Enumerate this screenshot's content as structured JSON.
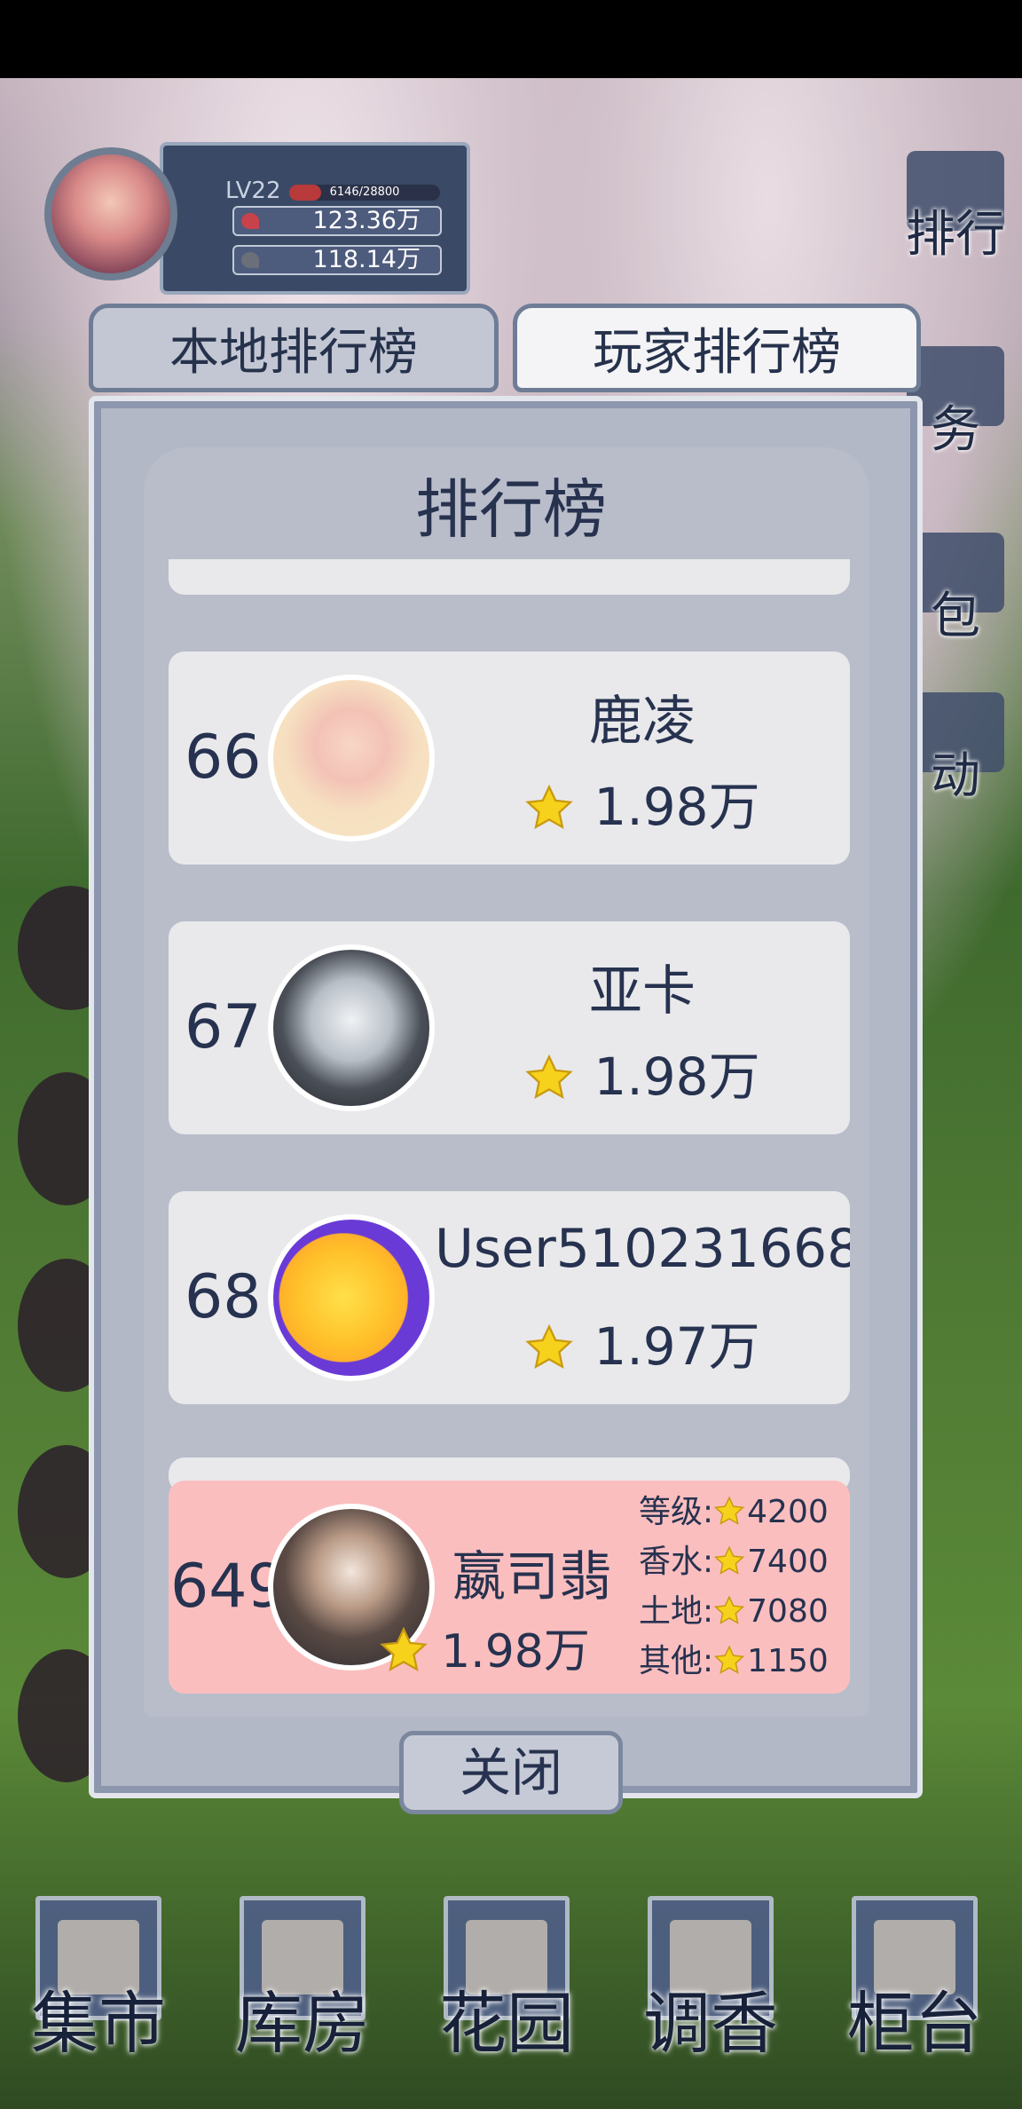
{
  "hud": {
    "level": "LV22",
    "exp_text": "6146/28800",
    "exp_progress": 0.213,
    "stat_1": "123.36万",
    "stat_2": "118.14万"
  },
  "side_menu": [
    {
      "label": "排行",
      "icon": "ranking-icon"
    },
    {
      "label": "务",
      "icon": "task-icon"
    },
    {
      "label": "包",
      "icon": "bag-icon"
    },
    {
      "label": "动",
      "icon": "activity-icon"
    }
  ],
  "tabs": {
    "local": "本地排行榜",
    "player": "玩家排行榜"
  },
  "modal": {
    "title": "排行榜",
    "close_label": "关闭"
  },
  "entries": [
    {
      "rank": "66",
      "name": "鹿凌",
      "score": "1.98万"
    },
    {
      "rank": "67",
      "name": "亚卡",
      "score": "1.98万"
    },
    {
      "rank": "68",
      "name": "User510231668",
      "score": "1.97万"
    }
  ],
  "self_entry": {
    "rank": "649",
    "name": "嬴司翡",
    "score": "1.98万",
    "stats": [
      {
        "label": "等级:",
        "value": "4200"
      },
      {
        "label": "香水:",
        "value": "7400"
      },
      {
        "label": "土地:",
        "value": "7080"
      },
      {
        "label": "其他:",
        "value": "1150"
      }
    ]
  },
  "bottom_nav": [
    {
      "label": "集市",
      "icon": "market-icon"
    },
    {
      "label": "库房",
      "icon": "warehouse-icon"
    },
    {
      "label": "花园",
      "icon": "garden-icon"
    },
    {
      "label": "调香",
      "icon": "perfume-icon"
    },
    {
      "label": "柜台",
      "icon": "counter-icon"
    }
  ],
  "colors": {
    "accent_text": "#26324f",
    "self_highlight": "#fbbebf",
    "star": "#f7d21c"
  }
}
